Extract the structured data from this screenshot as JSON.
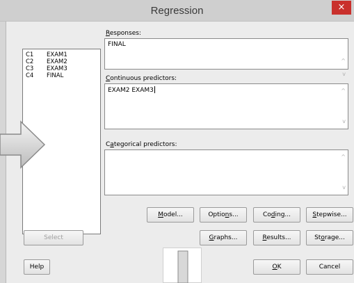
{
  "window": {
    "title": "Regression",
    "close_glyph": "×"
  },
  "variables": [
    {
      "col": "C1",
      "name": "EXAM1"
    },
    {
      "col": "C2",
      "name": "EXAM2"
    },
    {
      "col": "C3",
      "name": "EXAM3"
    },
    {
      "col": "C4",
      "name": "FINAL"
    }
  ],
  "responses": {
    "label_key": "R",
    "label_rest": "esponses:",
    "value": "FINAL"
  },
  "continuous": {
    "label_key": "C",
    "label_rest": "ontinuous predictors:",
    "value": "EXAM2 EXAM3"
  },
  "categorical": {
    "label_pre": "C",
    "label_key": "a",
    "label_rest": "tegorical predictors:",
    "value": ""
  },
  "buttons": {
    "model": {
      "pre": "",
      "key": "M",
      "post": "odel..."
    },
    "options": {
      "pre": "Optio",
      "key": "n",
      "post": "s..."
    },
    "coding": {
      "pre": "Co",
      "key": "d",
      "post": "ing..."
    },
    "stepwise": {
      "pre": "",
      "key": "S",
      "post": "tepwise..."
    },
    "graphs": {
      "pre": "",
      "key": "G",
      "post": "raphs..."
    },
    "results": {
      "pre": "",
      "key": "R",
      "post": "esults..."
    },
    "storage": {
      "pre": "St",
      "key": "o",
      "post": "rage..."
    },
    "ok": {
      "pre": "",
      "key": "O",
      "post": "K"
    },
    "select": "Select",
    "help": "Help",
    "cancel": "Cancel"
  },
  "scroll": {
    "up": "^",
    "down": "v"
  },
  "colors": {
    "close_button": "#c9302c",
    "dialog_bg": "#ececec",
    "title_bg": "#cfcfcf"
  }
}
